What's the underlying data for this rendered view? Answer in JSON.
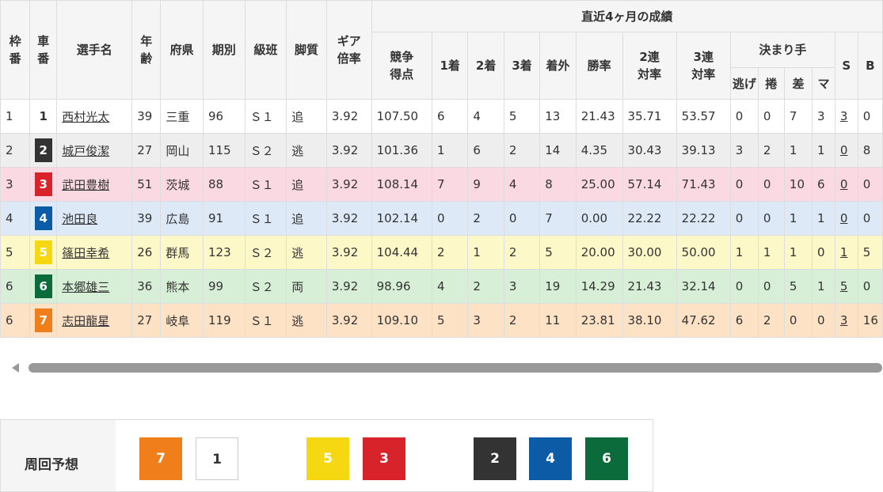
{
  "headers": {
    "waku": [
      "枠",
      "番"
    ],
    "car": [
      "車",
      "番"
    ],
    "name": "選手名",
    "age": [
      "年",
      "齢"
    ],
    "pref": "府県",
    "term": "期別",
    "class": "級班",
    "style": "脚質",
    "gear": [
      "ギア",
      "倍率"
    ],
    "recent_group": "直近4ヶ月の成績",
    "score": [
      "競争",
      "得点"
    ],
    "first": "1着",
    "second": "2着",
    "third": "3着",
    "outside": "着外",
    "win_rate": "勝率",
    "top2": [
      "2連",
      "対率"
    ],
    "top3": [
      "3連",
      "対率"
    ],
    "kimarite": "決まり手",
    "nige": "逃げ",
    "makuri": "捲",
    "sashi": "差",
    "mark": "マ",
    "s": "S",
    "b": "B"
  },
  "riders": [
    {
      "waku": "1",
      "car": "1",
      "name": "西村光太",
      "age": "39",
      "pref": "三重",
      "term": "96",
      "class": "Ｓ１",
      "style": "追",
      "gear": "3.92",
      "score": "107.50",
      "first": "6",
      "second": "4",
      "third": "5",
      "outside": "13",
      "win_rate": "21.43",
      "top2": "35.71",
      "top3": "53.57",
      "nige": "0",
      "makuri": "0",
      "sashi": "7",
      "mark": "3",
      "s": "3",
      "b": "0",
      "row_bg": "#ffffff",
      "car_bg": "#ffffff",
      "car_fg": "#333333"
    },
    {
      "waku": "2",
      "car": "2",
      "name": "城戸俊潔",
      "age": "27",
      "pref": "岡山",
      "term": "115",
      "class": "Ｓ２",
      "style": "逃",
      "gear": "3.92",
      "score": "101.36",
      "first": "1",
      "second": "6",
      "third": "2",
      "outside": "14",
      "win_rate": "4.35",
      "top2": "30.43",
      "top3": "39.13",
      "nige": "3",
      "makuri": "2",
      "sashi": "1",
      "mark": "1",
      "s": "0",
      "b": "8",
      "row_bg": "#eeeeee",
      "car_bg": "#333333",
      "car_fg": "#ffffff"
    },
    {
      "waku": "3",
      "car": "3",
      "name": "武田豊樹",
      "age": "51",
      "pref": "茨城",
      "term": "88",
      "class": "Ｓ１",
      "style": "追",
      "gear": "3.92",
      "score": "108.14",
      "first": "7",
      "second": "9",
      "third": "4",
      "outside": "8",
      "win_rate": "25.00",
      "top2": "57.14",
      "top3": "71.43",
      "nige": "0",
      "makuri": "0",
      "sashi": "10",
      "mark": "6",
      "s": "0",
      "b": "0",
      "row_bg": "#fbd9e3",
      "car_bg": "#d8232a",
      "car_fg": "#ffffff"
    },
    {
      "waku": "4",
      "car": "4",
      "name": "池田良",
      "age": "39",
      "pref": "広島",
      "term": "91",
      "class": "Ｓ１",
      "style": "追",
      "gear": "3.92",
      "score": "102.14",
      "first": "0",
      "second": "2",
      "third": "0",
      "outside": "7",
      "win_rate": "0.00",
      "top2": "22.22",
      "top3": "22.22",
      "nige": "0",
      "makuri": "0",
      "sashi": "1",
      "mark": "1",
      "s": "0",
      "b": "0",
      "row_bg": "#dde9f6",
      "car_bg": "#0b5ba7",
      "car_fg": "#ffffff"
    },
    {
      "waku": "5",
      "car": "5",
      "name": "篠田幸希",
      "age": "26",
      "pref": "群馬",
      "term": "123",
      "class": "Ｓ２",
      "style": "逃",
      "gear": "3.92",
      "score": "104.44",
      "first": "2",
      "second": "1",
      "third": "2",
      "outside": "5",
      "win_rate": "20.00",
      "top2": "30.00",
      "top3": "50.00",
      "nige": "1",
      "makuri": "1",
      "sashi": "1",
      "mark": "0",
      "s": "1",
      "b": "5",
      "row_bg": "#fdf8c8",
      "car_bg": "#f5d812",
      "car_fg": "#ffffff"
    },
    {
      "waku": "6",
      "car": "6",
      "name": "本郷雄三",
      "age": "36",
      "pref": "熊本",
      "term": "99",
      "class": "Ｓ２",
      "style": "両",
      "gear": "3.92",
      "score": "98.96",
      "first": "4",
      "second": "2",
      "third": "3",
      "outside": "19",
      "win_rate": "14.29",
      "top2": "21.43",
      "top3": "32.14",
      "nige": "0",
      "makuri": "0",
      "sashi": "5",
      "mark": "1",
      "s": "5",
      "b": "0",
      "row_bg": "#d7efd6",
      "car_bg": "#0b6b3b",
      "car_fg": "#ffffff"
    },
    {
      "waku": "6",
      "car": "7",
      "name": "志田龍星",
      "age": "27",
      "pref": "岐阜",
      "term": "119",
      "class": "Ｓ１",
      "style": "逃",
      "gear": "3.92",
      "score": "109.10",
      "first": "5",
      "second": "3",
      "third": "2",
      "outside": "11",
      "win_rate": "23.81",
      "top2": "38.10",
      "top3": "47.62",
      "nige": "6",
      "makuri": "2",
      "sashi": "0",
      "mark": "0",
      "s": "3",
      "b": "16",
      "row_bg": "#fde2c6",
      "car_bg": "#f07f1b",
      "car_fg": "#ffffff"
    }
  ],
  "prediction": {
    "label": "周回予想",
    "boxes": [
      {
        "num": "7",
        "bg": "#f07f1b",
        "fg": "#ffffff"
      },
      {
        "num": "1",
        "bg": "#ffffff",
        "fg": "#333333"
      },
      {
        "num": "5",
        "bg": "#f5d812",
        "fg": "#ffffff"
      },
      {
        "num": "3",
        "bg": "#d8232a",
        "fg": "#ffffff"
      },
      {
        "num": "2",
        "bg": "#333333",
        "fg": "#ffffff"
      },
      {
        "num": "4",
        "bg": "#0b5ba7",
        "fg": "#ffffff"
      },
      {
        "num": "6",
        "bg": "#0b6b3b",
        "fg": "#ffffff"
      }
    ]
  },
  "scrollbar": {
    "arrow_icon": "triangle-left-icon"
  }
}
